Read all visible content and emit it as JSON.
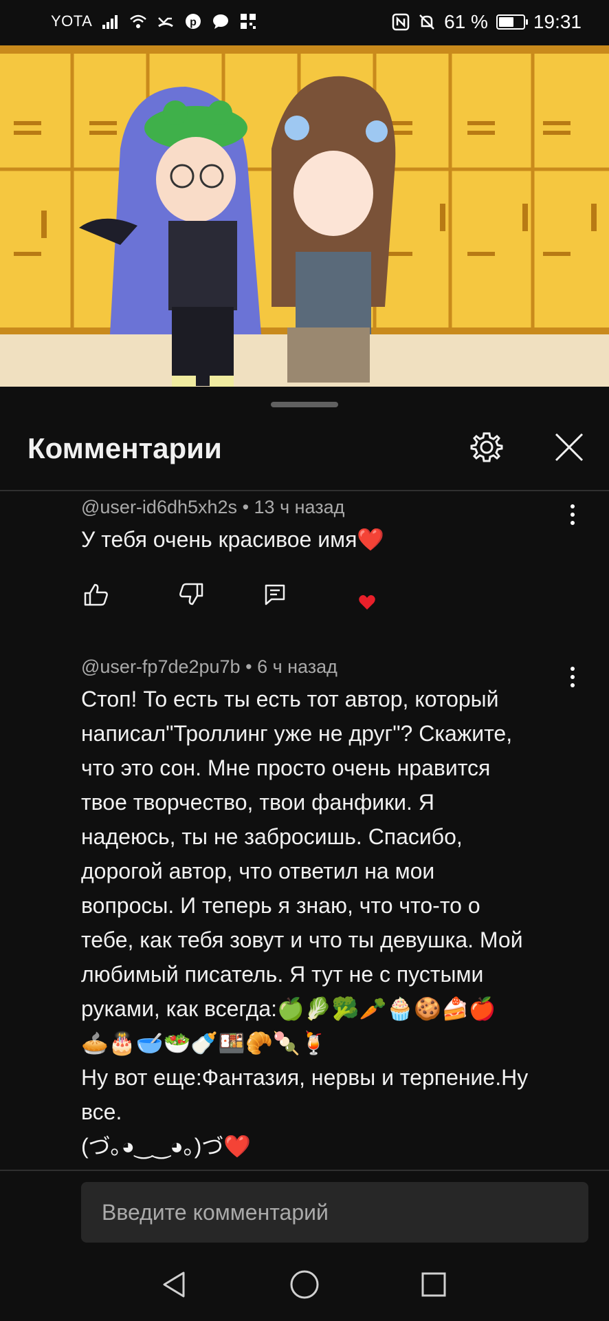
{
  "status_bar": {
    "carrier": "YOTA",
    "battery": "61 %",
    "battery_level": 0.61,
    "time": "19:31"
  },
  "video": {
    "thumbnail_icon": "gacha-characters-video-frame"
  },
  "comments_panel": {
    "title": "Комментарии",
    "settings_icon": "gear-icon",
    "close_icon": "close-icon"
  },
  "comments": [
    {
      "author": "@user-id6dh5xh2s",
      "time": "13 ч назад",
      "text": "У тебя очень красивое имя❤️"
    },
    {
      "author": "@user-fp7de2pu7b",
      "time": "6 ч назад",
      "text": "Стоп! То есть ты есть тот автор, который\nнаписал\"Троллинг уже не друг\"? Скажите,\nчто это сон. Мне просто очень нравится\nтвое творчество, твои фанфики. Я\nнадеюсь, ты не забросишь. Спасибо,\nдорогой автор, что ответил на мои\nвопросы. И теперь я знаю, что что-то о\nтебе, как тебя зовут и что ты девушка. Мой\nлюбимый писатель. Я тут не с пустыми\nруками, как всегда:🍏🥬🥦🥕🧁🍪🍰🍎\n🥧🎂🥣🥗🍼🍱🥐🍡🍹\nНу вот еще:Фантазия, нервы и терпение.Ну\nвсе.\n(づ｡◕‿‿◕｡)づ❤️"
    }
  ],
  "comment_input": {
    "placeholder": "Введите комментарий"
  },
  "colors": {
    "background": "#0f0f0f",
    "heart": "#e8202a"
  }
}
